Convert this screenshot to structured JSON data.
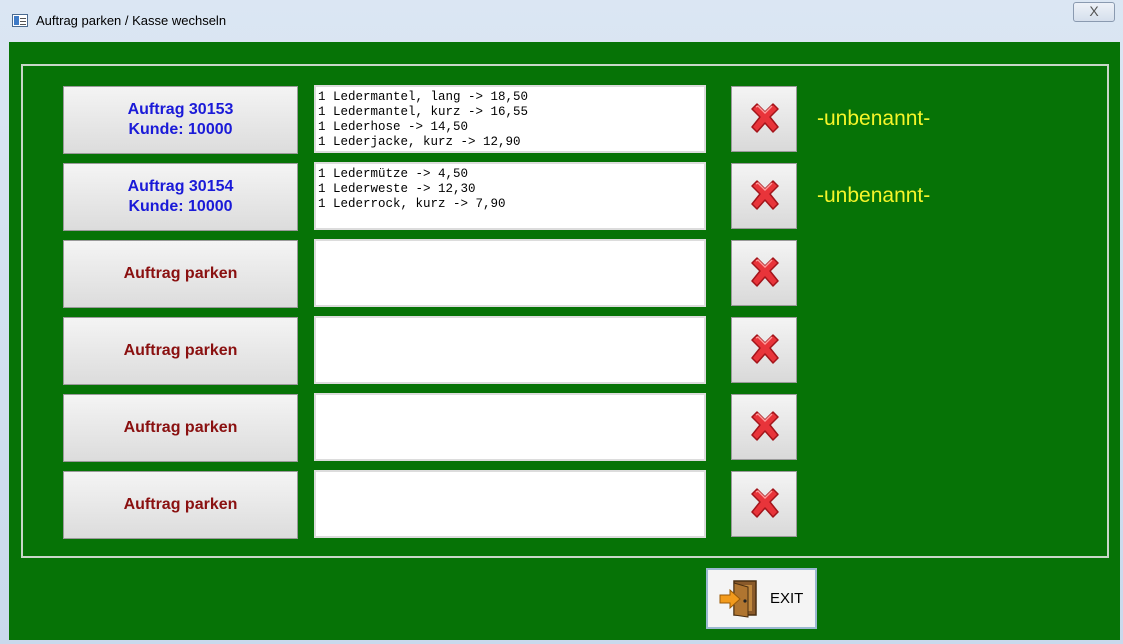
{
  "window": {
    "title": "Auftrag parken / Kasse wechseln",
    "close_symbol": "X"
  },
  "slots": [
    {
      "line1": "Auftrag 30153",
      "line2": "Kunde: 10000",
      "state": "filled",
      "items": [
        "1 Ledermantel, lang -> 18,50",
        "1 Ledermantel, kurz -> 16,55",
        "1 Lederhose -> 14,50",
        "1 Lederjacke, kurz -> 12,90"
      ],
      "name": "-unbenannt-"
    },
    {
      "line1": "Auftrag 30154",
      "line2": "Kunde: 10000",
      "state": "filled",
      "items": [
        "1 Ledermütze -> 4,50",
        "1 Lederweste -> 12,30",
        "1 Lederrock, kurz -> 7,90"
      ],
      "name": "-unbenannt-"
    },
    {
      "line1": "Auftrag parken",
      "line2": "",
      "state": "empty",
      "items": [],
      "name": ""
    },
    {
      "line1": "Auftrag parken",
      "line2": "",
      "state": "empty",
      "items": [],
      "name": ""
    },
    {
      "line1": "Auftrag parken",
      "line2": "",
      "state": "empty",
      "items": [],
      "name": ""
    },
    {
      "line1": "Auftrag parken",
      "line2": "",
      "state": "empty",
      "items": [],
      "name": ""
    }
  ],
  "exit": {
    "label": "EXIT",
    "icon": "exit-door-icon"
  },
  "delete_icon": "red-x-icon",
  "colors": {
    "background": "#067306",
    "filled_text": "#1a1ad8",
    "empty_text": "#8a1010",
    "name_text": "#f5f52a"
  }
}
